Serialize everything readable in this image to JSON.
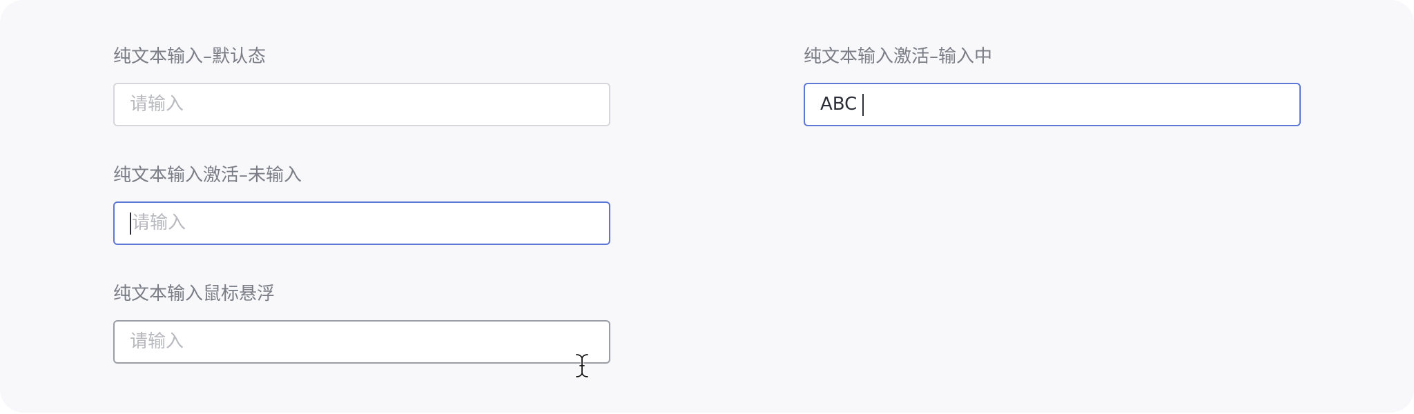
{
  "fields": {
    "default": {
      "label": "纯文本输入–默认态",
      "placeholder": "请输入"
    },
    "active_empty": {
      "label": "纯文本输入激活–未输入",
      "placeholder": "请输入"
    },
    "hover": {
      "label": "纯文本输入鼠标悬浮",
      "placeholder": "请输入"
    },
    "active_typing": {
      "label": "纯文本输入激活–输入中",
      "value": "ABC"
    }
  },
  "colors": {
    "background": "#f8f8fa",
    "label": "#7a7d86",
    "placeholder": "#b8b9bf",
    "border_default": "#d6d7dc",
    "border_focus": "#5b78d6",
    "border_hover": "#9a9ca6",
    "text": "#2a2d36"
  },
  "icons": {
    "cursor": "text-cursor-icon"
  }
}
